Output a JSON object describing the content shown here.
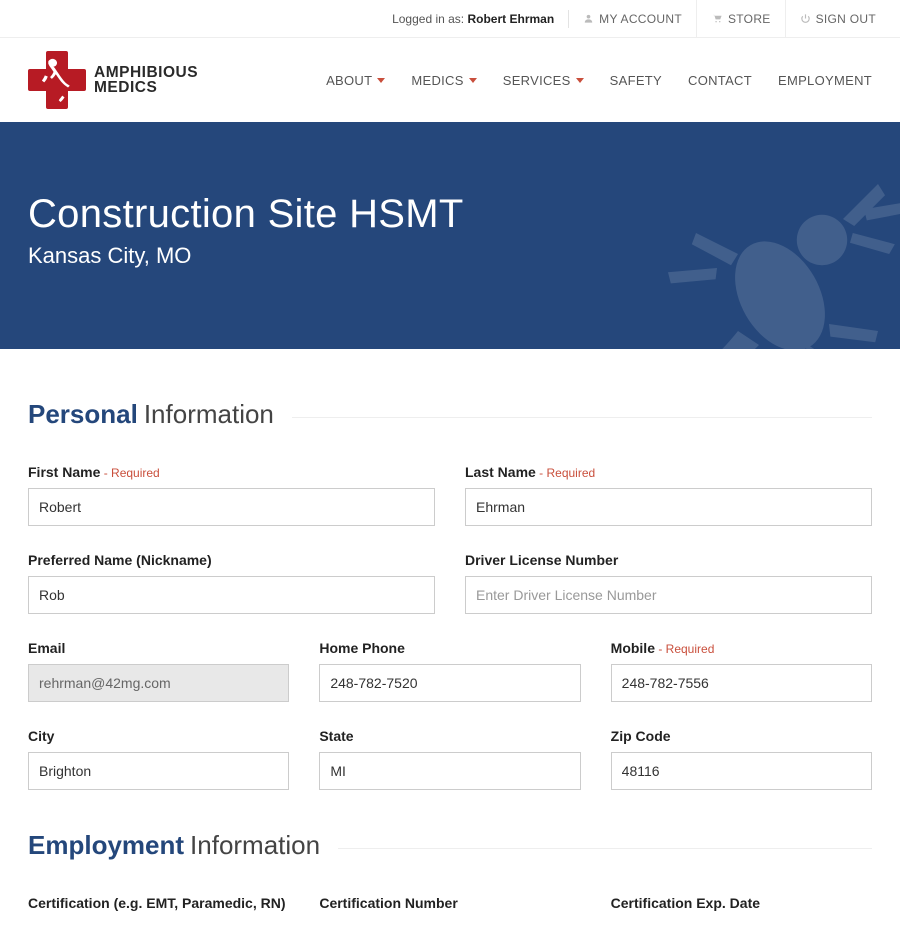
{
  "topbar": {
    "logged_in_prefix": "Logged in as: ",
    "user_name": "Robert Ehrman",
    "my_account": "MY ACCOUNT",
    "store": "STORE",
    "sign_out": "SIGN OUT"
  },
  "logo": {
    "line1": "AMPHIBIOUS",
    "line2": "MEDICS"
  },
  "nav": {
    "about": "ABOUT",
    "medics": "MEDICS",
    "services": "SERVICES",
    "safety": "SAFETY",
    "contact": "CONTACT",
    "employment": "EMPLOYMENT"
  },
  "hero": {
    "title": "Construction Site HSMT",
    "subtitle": "Kansas City, MO"
  },
  "sections": {
    "personal_accent": "Personal",
    "personal_rest": "Information",
    "employment_accent": "Employment",
    "employment_rest": "Information"
  },
  "labels": {
    "first_name": "First Name",
    "last_name": "Last Name",
    "preferred_name": "Preferred Name (Nickname)",
    "driver_license": "Driver License Number",
    "email": "Email",
    "home_phone": "Home Phone",
    "mobile": "Mobile",
    "city": "City",
    "state": "State",
    "zip": "Zip Code",
    "required": " - Required",
    "certification": "Certification (e.g. EMT, Paramedic, RN)",
    "cert_number": "Certification Number",
    "cert_exp": "Certification Exp. Date"
  },
  "placeholders": {
    "driver_license": "Enter Driver License Number"
  },
  "values": {
    "first_name": "Robert",
    "last_name": "Ehrman",
    "preferred_name": "Rob",
    "driver_license": "",
    "email": "rehrman@42mg.com",
    "home_phone": "248-782-7520",
    "mobile": "248-782-7556",
    "city": "Brighton",
    "state": "MI",
    "zip": "48116"
  }
}
